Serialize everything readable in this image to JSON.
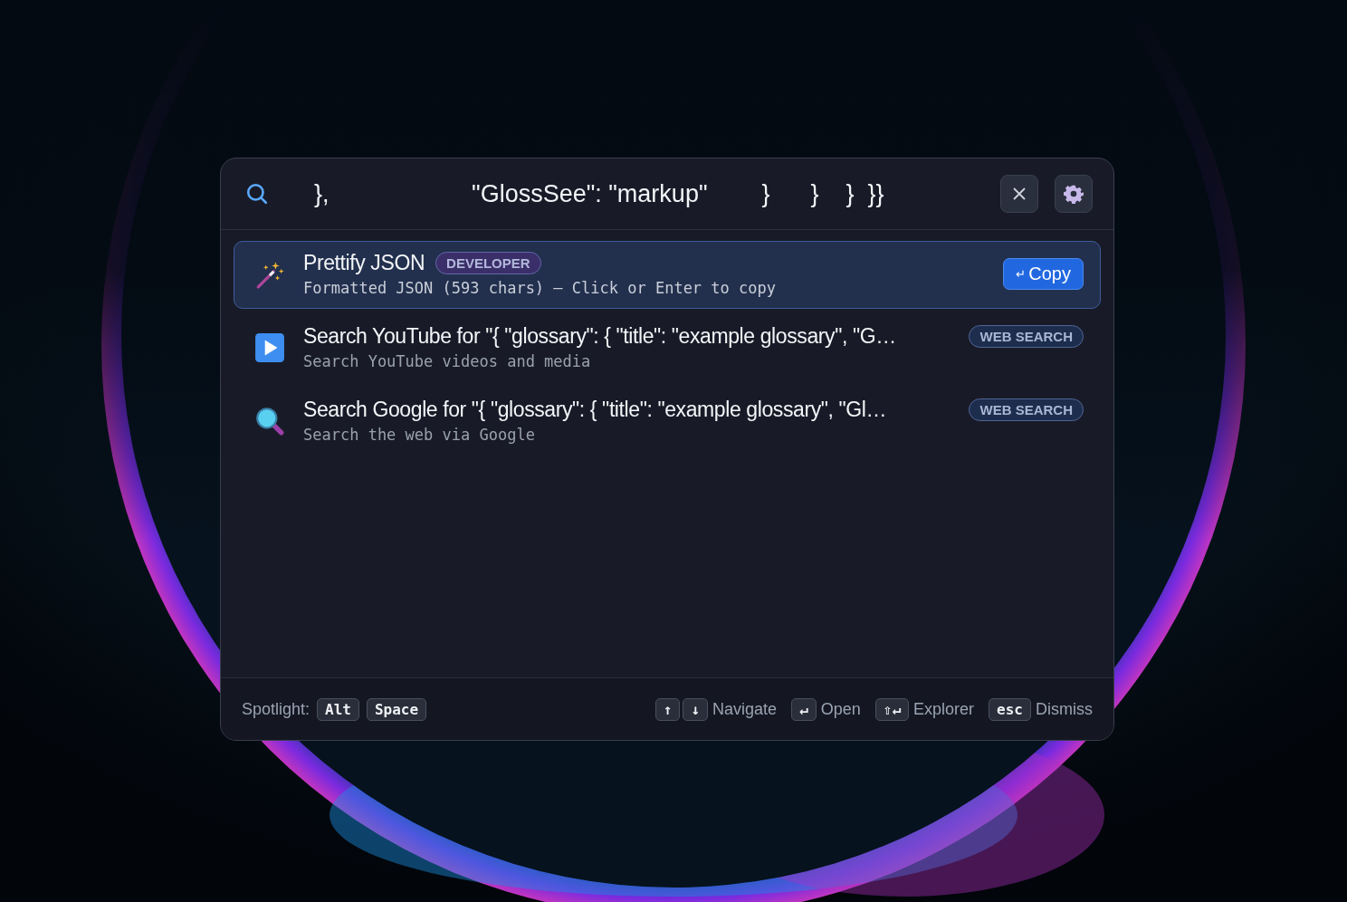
{
  "search": {
    "value": "},                     \"GlossSee\": \"markup\"        }      }    }  }}"
  },
  "results": [
    {
      "kind": "wand",
      "title": "Prettify JSON",
      "badge": {
        "text": "DEVELOPER",
        "color": "#3b2f6a"
      },
      "subtitle": "Formatted JSON (593 chars) — Click or Enter to copy",
      "selected": true,
      "action": {
        "icon": "↵",
        "label": "Copy"
      }
    },
    {
      "kind": "play",
      "title": "Search YouTube for \"{ \"glossary\": { \"title\": \"example glossary\", \"G…",
      "badge": {
        "text": "WEB SEARCH",
        "color": "#1d2d4e"
      },
      "subtitle": "Search YouTube videos and media",
      "selected": false
    },
    {
      "kind": "magnifier",
      "title": "Search Google for \"{ \"glossary\": { \"title\": \"example glossary\", \"Gl…",
      "badge": {
        "text": "WEB SEARCH",
        "color": "#1d2d4e"
      },
      "subtitle": "Search the web via Google",
      "selected": false
    }
  ],
  "footer": {
    "label": "Spotlight:",
    "shortcut": [
      "Alt",
      "Space"
    ],
    "hints": [
      {
        "keys": [
          "↑",
          "↓"
        ],
        "label": "Navigate"
      },
      {
        "keys": [
          "↵"
        ],
        "label": "Open"
      },
      {
        "keys": [
          "⇧↵"
        ],
        "label": "Explorer"
      },
      {
        "keys": [
          "esc"
        ],
        "label": "Dismiss"
      }
    ]
  }
}
